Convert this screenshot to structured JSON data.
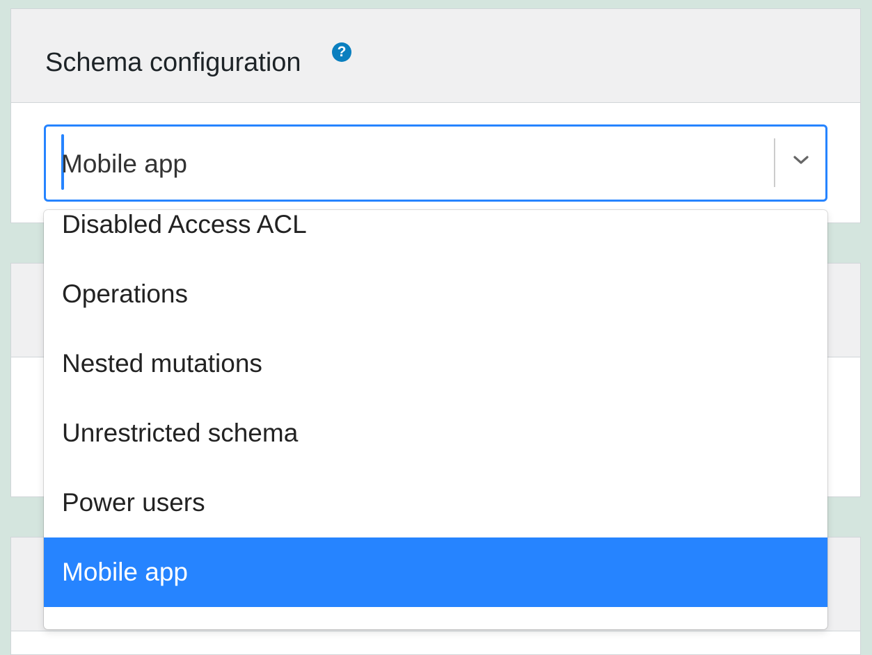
{
  "schema_config": {
    "title": "Schema configuration",
    "help_glyph": "?",
    "select": {
      "value": "Mobile app"
    },
    "options": [
      {
        "label": "Disabled Access ACL",
        "selected": false
      },
      {
        "label": "Operations",
        "selected": false
      },
      {
        "label": "Nested mutations",
        "selected": false
      },
      {
        "label": "Unrestricted schema",
        "selected": false
      },
      {
        "label": "Power users",
        "selected": false
      },
      {
        "label": "Mobile app",
        "selected": true
      }
    ]
  },
  "colors": {
    "accent": "#2684ff",
    "help_icon": "#0a7fbf",
    "background": "#d4e5de",
    "panel_header": "#f0f0f1"
  },
  "icons": {
    "help": "question-circle-icon",
    "dropdown": "chevron-down-icon"
  }
}
